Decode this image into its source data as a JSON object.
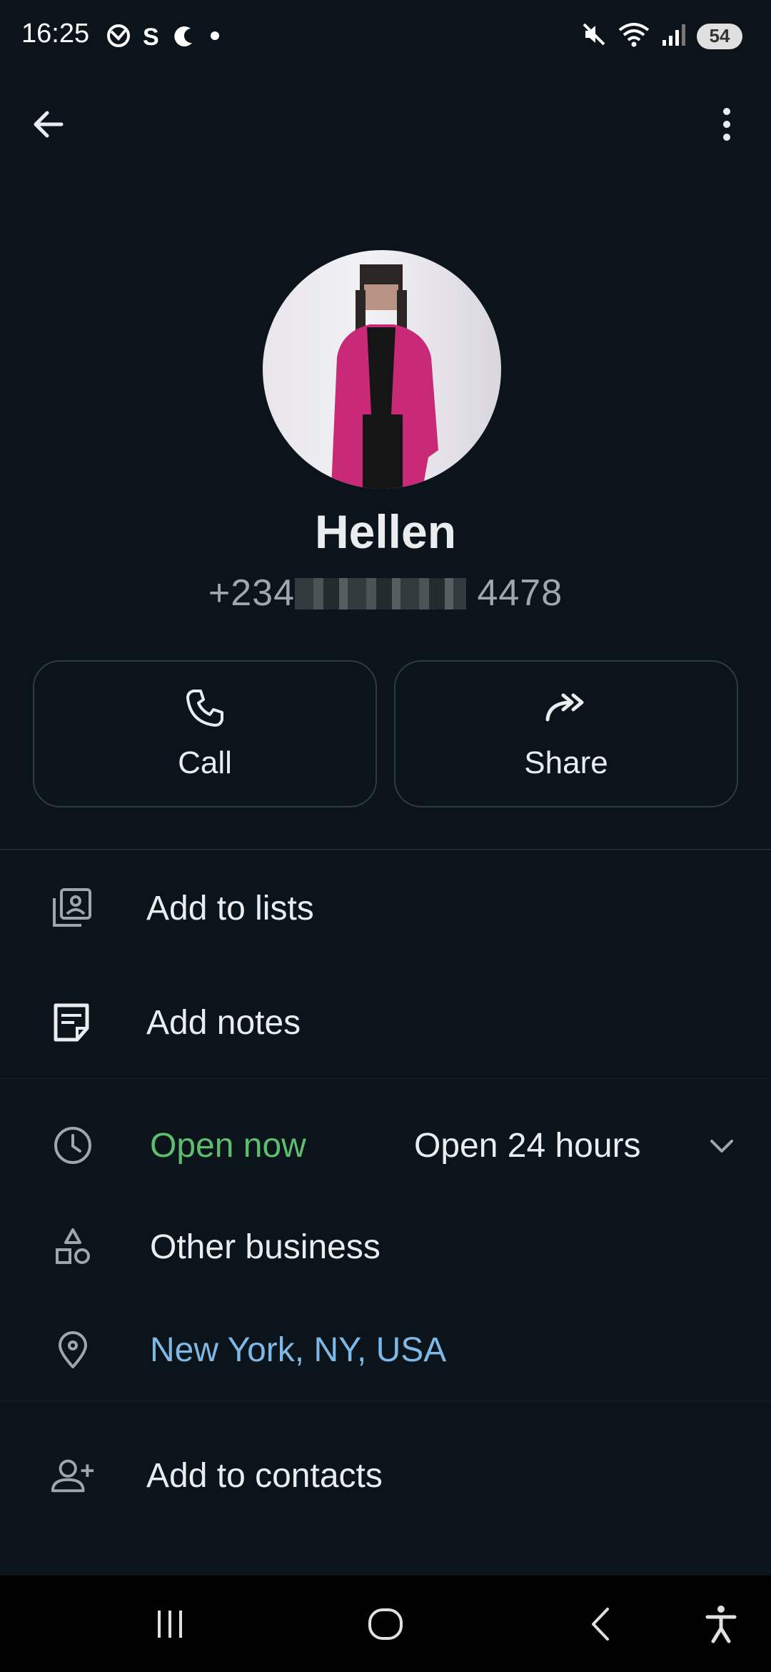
{
  "status_bar": {
    "time": "16:25",
    "left_icons": [
      "sync-icon",
      "s-app-icon",
      "moon-app-icon",
      "dot-icon"
    ],
    "right_icons": [
      "mute-icon",
      "wifi-icon",
      "signal-icon"
    ],
    "battery": "54"
  },
  "header": {
    "back_icon": "arrow-left-icon",
    "menu_icon": "more-vert-icon"
  },
  "contact": {
    "name": "Hellen",
    "phone_prefix": "+234",
    "phone_suffix": "4478"
  },
  "actions": {
    "call_label": "Call",
    "share_label": "Share"
  },
  "list": {
    "add_to_lists": "Add to lists",
    "add_notes": "Add notes",
    "hours_status": "Open now",
    "hours_value": "Open 24 hours",
    "category": "Other business",
    "location": "New York, NY, USA",
    "add_to_contacts": "Add to contacts"
  },
  "colors": {
    "background": "#0b141a",
    "open_green": "#5ebd6e",
    "link_blue": "#7eb8e6",
    "card_border": "#2f3b43"
  }
}
